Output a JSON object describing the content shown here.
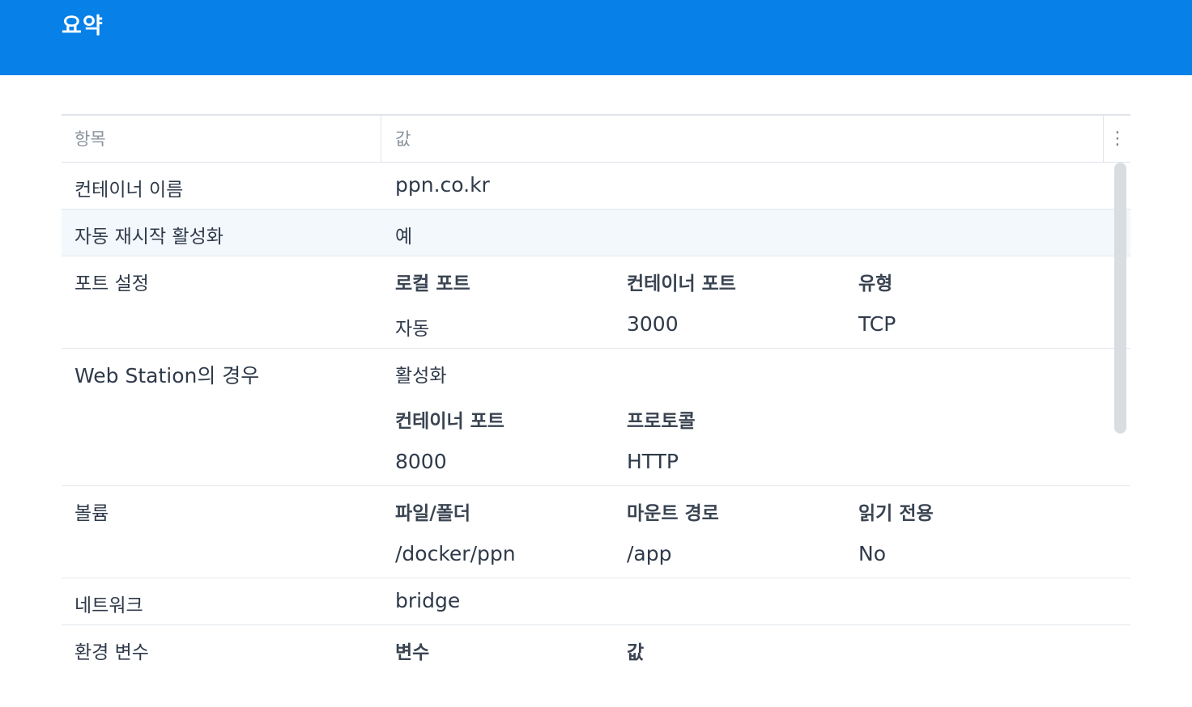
{
  "header": {
    "title": "요약"
  },
  "grid": {
    "columns": {
      "item": "항목",
      "value": "값"
    },
    "menu_icon": "vertical-dots-icon"
  },
  "rows": {
    "container_name": {
      "label": "컨테이너 이름",
      "value": "ppn.co.kr"
    },
    "auto_restart": {
      "label": "자동 재시작 활성화",
      "value": "예"
    },
    "port_settings": {
      "label": "포트 설정",
      "headers": [
        "로컬 포트",
        "컨테이너 포트",
        "유형"
      ],
      "values": [
        "자동",
        "3000",
        "TCP"
      ]
    },
    "web_station": {
      "label": "Web Station의 경우",
      "status": "활성화",
      "headers": [
        "컨테이너 포트",
        "프로토콜"
      ],
      "values": [
        "8000",
        "HTTP"
      ]
    },
    "volume": {
      "label": "볼륨",
      "headers": [
        "파일/폴더",
        "마운트 경로",
        "읽기 전용"
      ],
      "values": [
        "/docker/ppn",
        "/app",
        "No"
      ]
    },
    "network": {
      "label": "네트워크",
      "value": "bridge"
    },
    "env": {
      "label": "환경 변수",
      "headers": [
        "변수",
        "값"
      ]
    }
  },
  "colors": {
    "header_bg": "#0780e8",
    "alt_row_bg": "#f3f8fc",
    "border": "#dfe5ea"
  }
}
